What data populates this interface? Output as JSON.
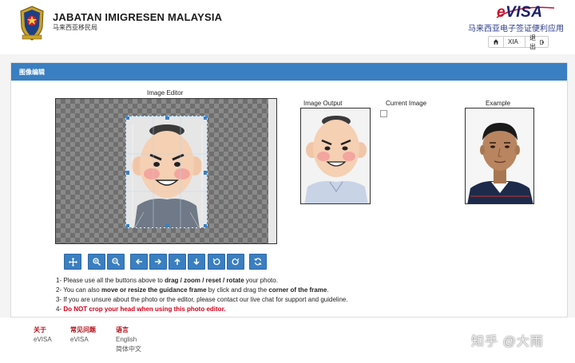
{
  "header": {
    "org_name_en": "JABATAN IMIGRESEN MALAYSIA",
    "org_name_zh": "马来西亚移民局",
    "brand": "eVISA",
    "brand_e": "e",
    "brand_rest": "VISA",
    "app_name_zh": "马来西亚电子签证便利应用",
    "lang_selector": "XIA",
    "logout_label": "退出"
  },
  "panel": {
    "title": "图像编辑",
    "editor_label": "Image Editor",
    "output_label": "Image Output",
    "current_label": "Current Image",
    "example_label": "Example"
  },
  "toolbar": {
    "move_icon": "move-icon",
    "zoom_in_icon": "zoom-in-icon",
    "zoom_out_icon": "zoom-out-icon",
    "left_icon": "arrow-left-icon",
    "right_icon": "arrow-right-icon",
    "up_icon": "arrow-up-icon",
    "down_icon": "arrow-down-icon",
    "rotate_left_icon": "rotate-left-icon",
    "rotate_right_icon": "rotate-right-icon",
    "reset_icon": "reset-icon"
  },
  "instructions": {
    "l1_pre": "1- Please use all the buttons above to ",
    "l1_bold": "drag / zoom / reset / rotate",
    "l1_post": " your photo.",
    "l2_pre": "2- You can also ",
    "l2_bold1": "move or resize the guidance frame",
    "l2_mid": " by click and drag the ",
    "l2_bold2": "corner of the frame",
    "l2_post": ".",
    "l3": "3- If you are unsure about the photo or the editor, please contact our live chat for support and guideline.",
    "l4_pre": "4- ",
    "l4_red": "Do NOT crop your head when using this photo editor."
  },
  "footer": {
    "about_title": "关于",
    "about_link": "eVISA",
    "faq_title": "常见问题",
    "faq_link": "eVISA",
    "lang_title": "语言",
    "lang_en": "English",
    "lang_zh": "简体中文"
  },
  "watermark": "知乎 @大雨",
  "colors": {
    "accent": "#3a7fc1",
    "danger": "#d0021b",
    "footer_title": "#b0101a"
  }
}
